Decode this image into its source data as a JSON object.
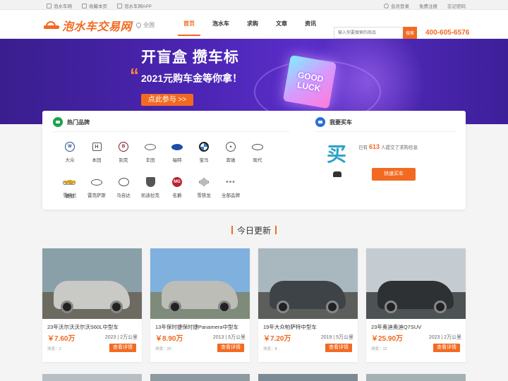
{
  "topbar": {
    "left": [
      "泡水车网",
      "收藏本页",
      "泡水车网APP"
    ],
    "right": [
      "会员登录",
      "免费注册",
      "忘记密码"
    ]
  },
  "header": {
    "logo": "泡水车交易网",
    "location": "全国",
    "nav": [
      "首页",
      "泡水车",
      "求购",
      "文章",
      "资讯"
    ],
    "search_placeholder": "输入你要搜索的商品",
    "search_button": "搜索",
    "phone": "400-605-6576"
  },
  "banner": {
    "title": "开盲盒 攒车标",
    "subtitle": "2021元购车金等你拿！",
    "cta": "点此参与 >>",
    "cube_text": [
      "GOOD",
      "LUCK"
    ]
  },
  "brands": {
    "title": "热门品牌",
    "items": [
      {
        "name": "大众",
        "icon": "vw-logo-icon"
      },
      {
        "name": "本田",
        "icon": "honda-logo-icon"
      },
      {
        "name": "别克",
        "icon": "buick-logo-icon"
      },
      {
        "name": "丰田",
        "icon": "toyota-logo-icon"
      },
      {
        "name": "福特",
        "icon": "ford-logo-icon"
      },
      {
        "name": "宝马",
        "icon": "bmw-logo-icon"
      },
      {
        "name": "奔驰",
        "icon": "benz-logo-icon"
      },
      {
        "name": "现代",
        "icon": "hyundai-logo-icon"
      },
      {
        "name": "奥迪",
        "icon": "audi-logo-icon"
      },
      {
        "name": "雪佛兰",
        "icon": "chevrolet-logo-icon"
      },
      {
        "name": "雷克萨斯",
        "icon": "lexus-logo-icon"
      },
      {
        "name": "马自达",
        "icon": "mazda-logo-icon"
      },
      {
        "name": "凯迪拉克",
        "icon": "cadillac-logo-icon"
      },
      {
        "name": "名爵",
        "icon": "mg-logo-icon"
      },
      {
        "name": "雪铁龙",
        "icon": "citroen-logo-icon"
      },
      {
        "name": "全部品牌",
        "icon": "more-dots-icon"
      }
    ]
  },
  "buy": {
    "title": "我要买车",
    "big_char": "买",
    "text_pre": "已有",
    "count": "613",
    "text_post": "人提交了求购信息",
    "button": "快速买车"
  },
  "today": {
    "title": "今日更新",
    "cars": [
      {
        "title": "23年沃尔沃沃尔沃S60L中型车",
        "price": "￥7.60万",
        "meta": "2023 | 2万公里",
        "views": "浏览：2",
        "button": "查看详情",
        "car_color": "#c9c9c6",
        "sky": "#8aa0a8",
        "ground": "#6d6a62"
      },
      {
        "title": "13年保时捷保时捷Panamera中型车",
        "price": "￥8.90万",
        "meta": "2013 | 5万公里",
        "views": "浏览：20",
        "button": "查看详情",
        "car_color": "#bdbdb8",
        "sky": "#7fb0de",
        "ground": "#7e8a7a"
      },
      {
        "title": "19年大众帕萨特中型车",
        "price": "￥7.20万",
        "meta": "2019 | 5万公里",
        "views": "浏览：8",
        "button": "查看详情",
        "car_color": "#3e4347",
        "sky": "#a9b8bf",
        "ground": "#5c5e5c"
      },
      {
        "title": "23年奥迪奥迪Q7SUV",
        "price": "￥25.90万",
        "meta": "2023 | 2万公里",
        "views": "浏览：12",
        "button": "查看详情",
        "car_color": "#2d3133",
        "sky": "#c5ccd1",
        "ground": "#4d5355"
      }
    ]
  }
}
